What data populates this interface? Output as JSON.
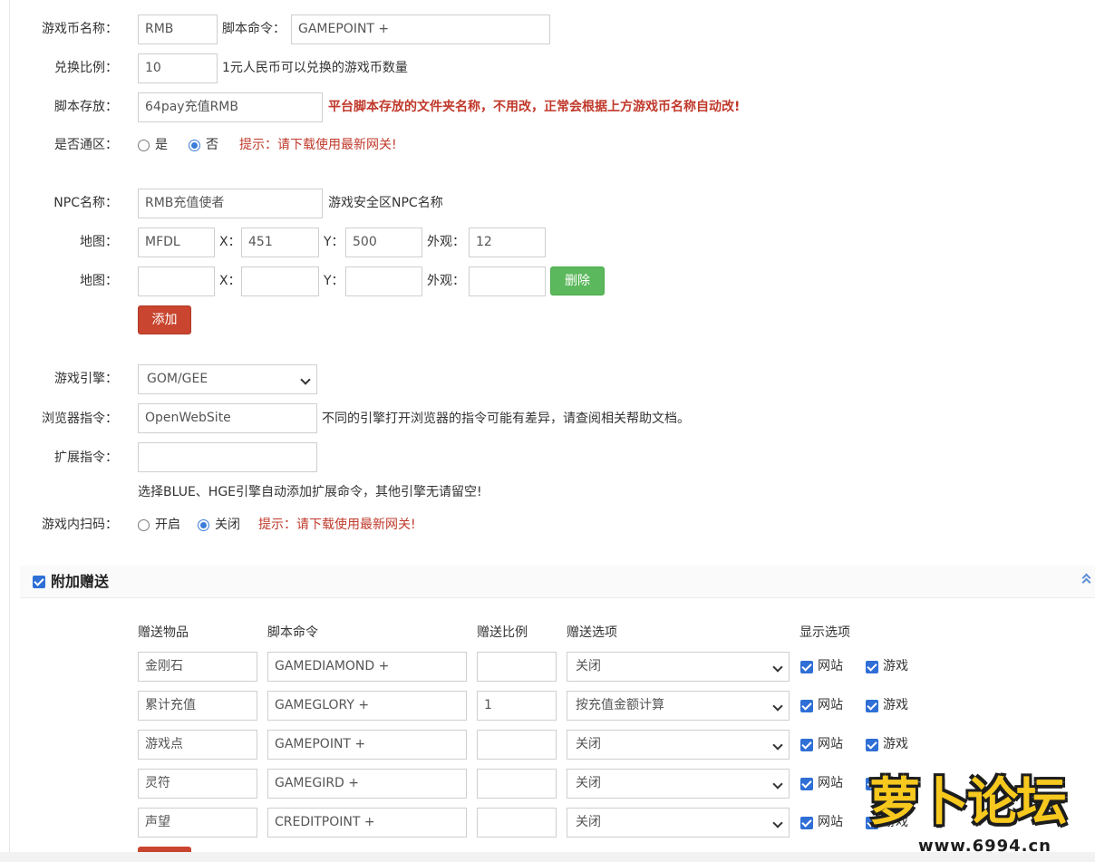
{
  "form": {
    "currency_name": {
      "label": "游戏币名称：",
      "value": "RMB"
    },
    "script_cmd": {
      "label": "脚本命令：",
      "value": "GAMEPOINT +"
    },
    "ratio": {
      "label": "兑换比例：",
      "value": "10",
      "hint": "1元人民币可以兑换的游戏币数量"
    },
    "script_dir": {
      "label": "脚本存放：",
      "value": "64pay充值RMB",
      "hint": "平台脚本存放的文件夹名称，不用改，正常会根据上方游戏币名称自动改!"
    },
    "all_server": {
      "label": "是否通区：",
      "yes": "是",
      "no": "否",
      "selected": "否",
      "hint": "提示：请下载使用最新网关!"
    },
    "npc_name": {
      "label": "NPC名称：",
      "value": "RMB充值使者",
      "hint": "游戏安全区NPC名称"
    },
    "map_rows": [
      {
        "label": "地图：",
        "map": "MFDL",
        "x_label": "X：",
        "x": "451",
        "y_label": "Y：",
        "y": "500",
        "look_label": "外观：",
        "look": "12"
      },
      {
        "label": "地图：",
        "map": "",
        "x_label": "X：",
        "x": "",
        "y_label": "Y：",
        "y": "",
        "look_label": "外观：",
        "look": "",
        "delete": "删除"
      }
    ],
    "add_button": "添加",
    "engine": {
      "label": "游戏引擎：",
      "value": "GOM/GEE"
    },
    "browser_cmd": {
      "label": "浏览器指令：",
      "value": "OpenWebSite",
      "hint": "不同的引擎打开浏览器的指令可能有差异，请查阅相关帮助文档。"
    },
    "ext_cmd": {
      "label": "扩展指令：",
      "value": "",
      "hint": "选择BLUE、HGE引擎自动添加扩展命令，其他引擎无请留空!"
    },
    "qr_scan": {
      "label": "游戏内扫码：",
      "on": "开启",
      "off": "关闭",
      "selected": "关闭",
      "hint": "提示：请下载使用最新网关!"
    }
  },
  "bonus": {
    "title": "附加赠送",
    "checked": true,
    "headers": [
      "赠送物品",
      "脚本命令",
      "赠送比例",
      "赠送选项",
      "显示选项"
    ],
    "site_label": "网站",
    "game_label": "游戏",
    "rows": [
      {
        "item": "金刚石",
        "cmd": "GAMEDIAMOND +",
        "ratio": "",
        "option": "关闭",
        "site": true,
        "game": true
      },
      {
        "item": "累计充值",
        "cmd": "GAMEGLORY +",
        "ratio": "1",
        "option": "按充值金额计算",
        "site": true,
        "game": true
      },
      {
        "item": "游戏点",
        "cmd": "GAMEPOINT +",
        "ratio": "",
        "option": "关闭",
        "site": true,
        "game": true
      },
      {
        "item": "灵符",
        "cmd": "GAMEGIRD +",
        "ratio": "",
        "option": "关闭",
        "site": true,
        "game": true
      },
      {
        "item": "声望",
        "cmd": "CREDITPOINT +",
        "ratio": "",
        "option": "关闭",
        "site": true,
        "game": true
      }
    ]
  },
  "watermark": {
    "text": "萝卜论坛",
    "url": "www.6994.cn"
  },
  "colors": {
    "accent": "#2f6fd6",
    "danger": "#c9452f",
    "success": "#5cb85c",
    "hint_red": "#c0392b"
  }
}
